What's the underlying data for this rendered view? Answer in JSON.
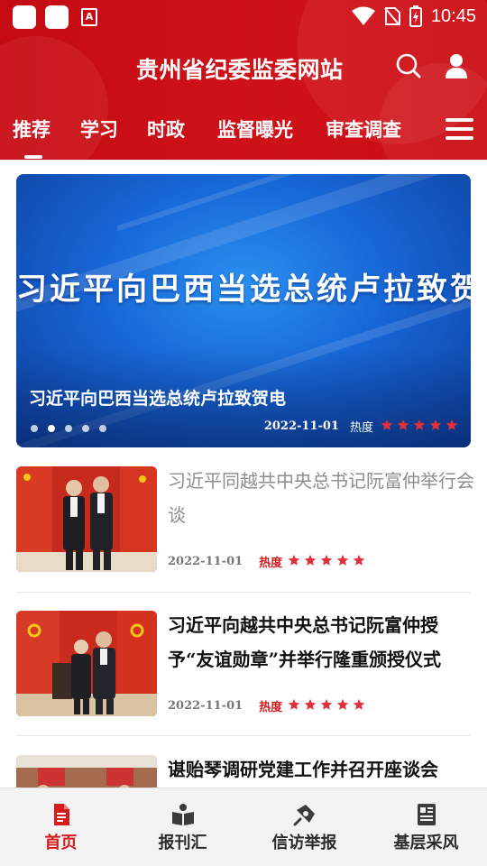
{
  "status_bar": {
    "time": "10:45",
    "app_badge": "A"
  },
  "header": {
    "title": "贵州省纪委监委网站",
    "icons": [
      "search-icon",
      "user-icon"
    ]
  },
  "nav": {
    "tabs": [
      {
        "label": "推荐",
        "active": true
      },
      {
        "label": "学习",
        "active": false
      },
      {
        "label": "时政",
        "active": false
      },
      {
        "label": "监督曝光",
        "active": false
      },
      {
        "label": "审查调查",
        "active": false
      }
    ],
    "menu_icon": "hamburger-icon"
  },
  "banner": {
    "image_text": "习近平向巴西当选总统卢拉致贺电",
    "caption": "习近平向巴西当选总统卢拉致贺电",
    "date": "2022-11-01",
    "heat_label": "热度",
    "heat_stars": 5,
    "slide_count": 5,
    "active_slide": 2
  },
  "news": [
    {
      "title": "习近平同越共中央总书记阮富仲举行会谈",
      "date": "2022-11-01",
      "heat_label": "热度",
      "heat_stars": 5,
      "read": true
    },
    {
      "title": "习近平向越共中央总书记阮富仲授予“友谊勋章”并举行隆重颁授仪式",
      "date": "2022-11-01",
      "heat_label": "热度",
      "heat_stars": 5,
      "read": false
    },
    {
      "title": "谌贻琴调研党建工作并召开座谈会",
      "read": false
    }
  ],
  "bottom_nav": {
    "items": [
      {
        "label": "首页",
        "icon": "document-icon",
        "active": true
      },
      {
        "label": "报刊汇",
        "icon": "book-icon",
        "active": false
      },
      {
        "label": "信访举报",
        "icon": "pen-icon",
        "active": false
      },
      {
        "label": "基层采风",
        "icon": "newspaper-icon",
        "active": false
      }
    ]
  },
  "colors": {
    "header_red": "#c90d14",
    "accent_red": "#d51b1f",
    "star_red": "#e0303a",
    "banner_blue": "#1766d6"
  }
}
